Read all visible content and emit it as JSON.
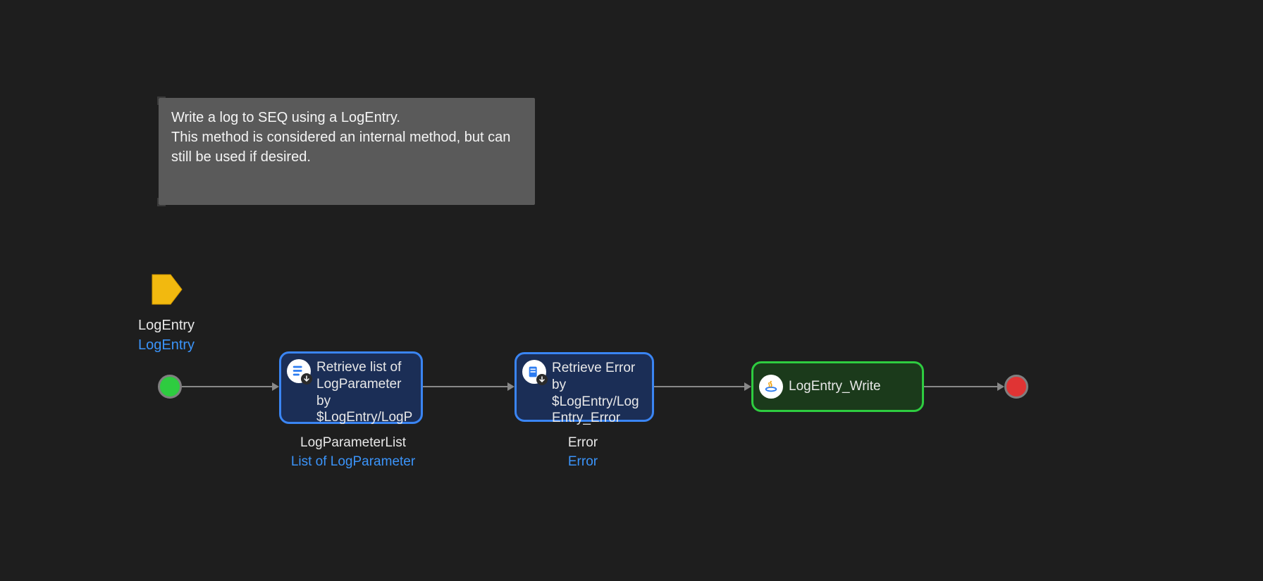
{
  "comment": "Write a log to SEQ using a LogEntry.\nThis method is considered an internal method, but can still be used if desired.",
  "parameter": {
    "name": "LogEntry",
    "type": "LogEntry"
  },
  "nodes": {
    "start": {
      "kind": "start"
    },
    "retrieve_list": {
      "title": "Retrieve list of LogParameter by $LogEntry/LogP",
      "output_name": "LogParameterList",
      "output_type": "List of LogParameter"
    },
    "retrieve_error": {
      "title": "Retrieve Error by $LogEntry/LogEntry_Error",
      "output_name": "Error",
      "output_type": "Error"
    },
    "logentry_write": {
      "title": "LogEntry_Write"
    },
    "end": {
      "kind": "end"
    }
  }
}
